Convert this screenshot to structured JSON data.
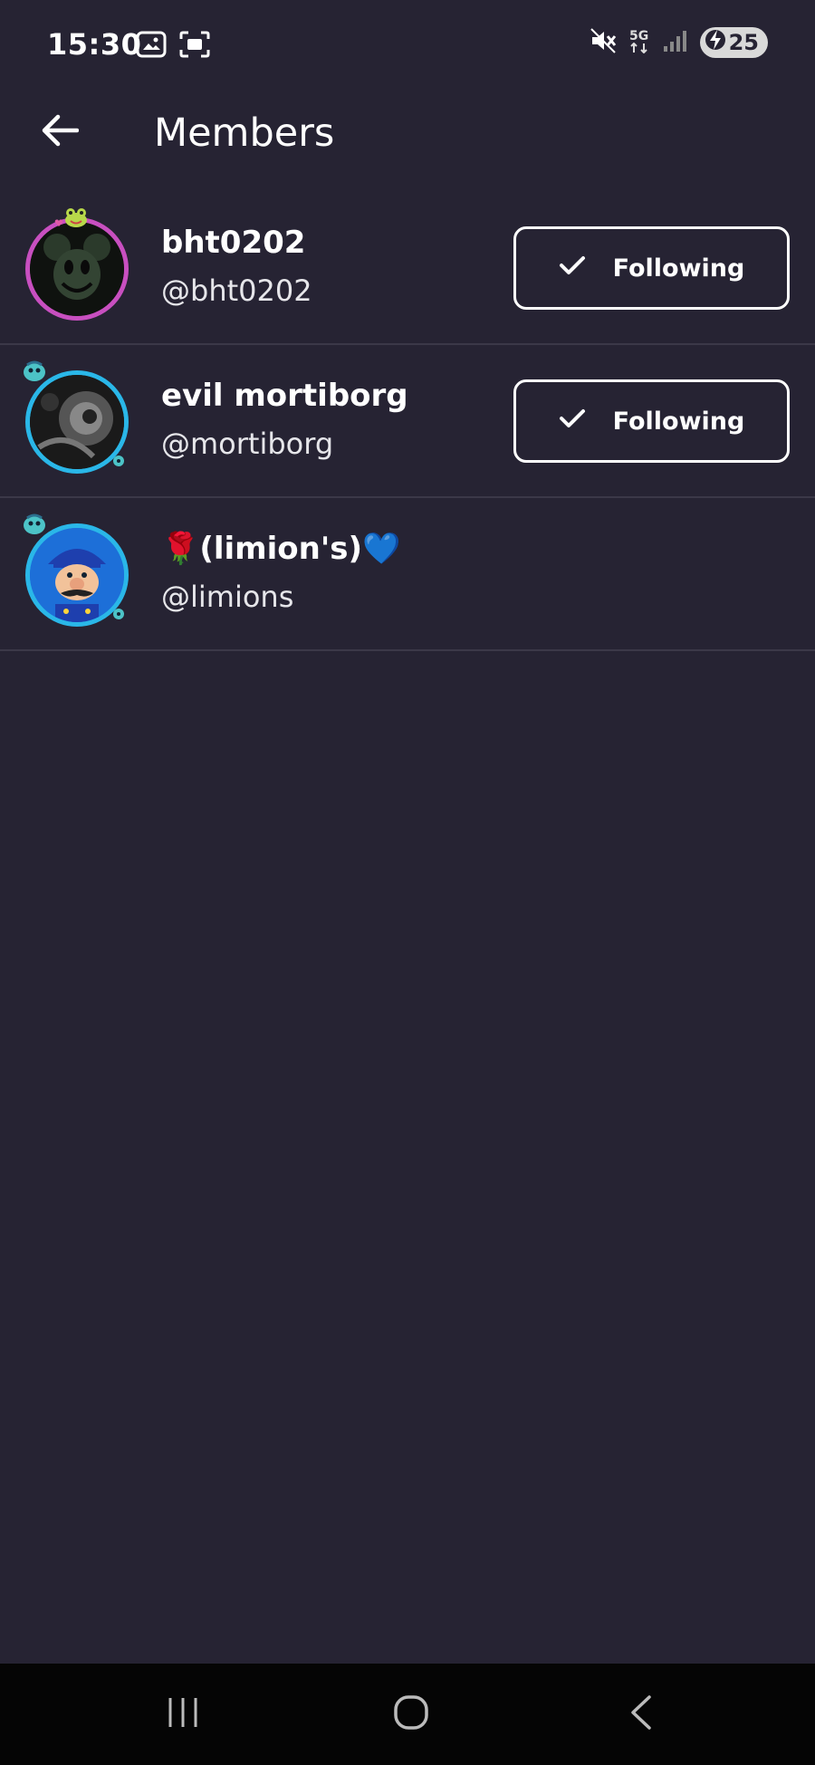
{
  "status_bar": {
    "time": "15:30",
    "network_label_top": "5G",
    "battery_level": "25",
    "icons": [
      "gallery-icon",
      "screenshot-icon",
      "mute-icon",
      "signal-icon",
      "charging-icon"
    ]
  },
  "header": {
    "title": "Members",
    "back_icon": "arrow-left-icon"
  },
  "members": [
    {
      "name": "bht0202",
      "handle": "@bht0202",
      "follow_label": "Following",
      "follow_icon": "check-icon",
      "avatar_ring_color": "#c84fc0"
    },
    {
      "name": "evil mortiborg",
      "handle": "@mortiborg",
      "follow_label": "Following",
      "follow_icon": "check-icon",
      "avatar_ring_color": "#2ab7e8"
    },
    {
      "name": "🌹(limion's)💙",
      "handle": "@limions",
      "avatar_ring_color": "#2ab7e8"
    }
  ],
  "nav_bar": {
    "buttons": [
      "recents-icon",
      "home-icon",
      "back-icon"
    ]
  },
  "colors": {
    "background": "#262333",
    "divider": "#3b3848",
    "nav_background": "#050505",
    "text": "#ffffff"
  }
}
